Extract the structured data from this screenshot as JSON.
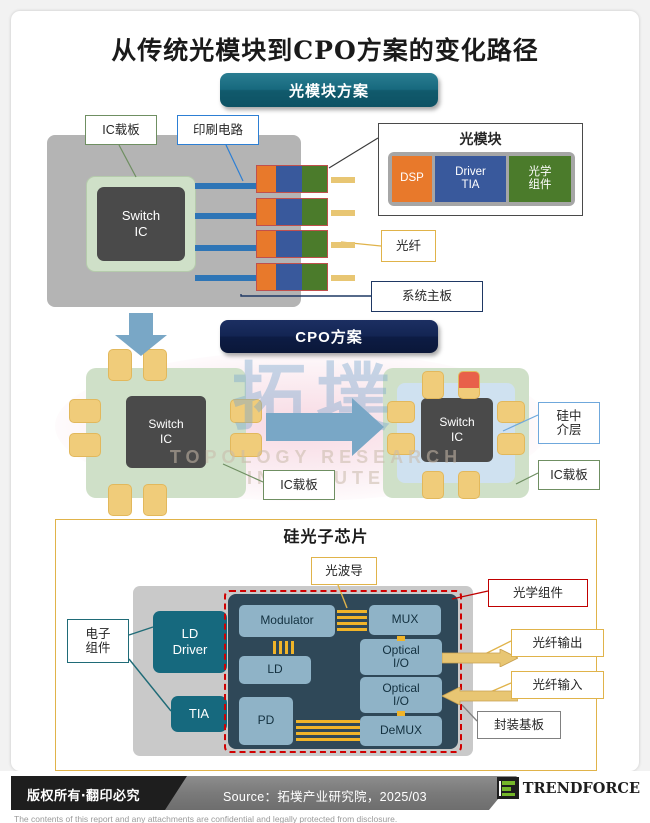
{
  "page": {
    "title": "从传统光模块到CPO方案的变化路径"
  },
  "sections": {
    "optical_module": {
      "pill_label": "光模块方案",
      "labels": {
        "ic_substrate": "IC载板",
        "pcb": "印刷电路",
        "fiber": "光纤",
        "system_board": "系统主板"
      },
      "switch_ic": {
        "line1": "Switch",
        "line2": "IC"
      },
      "module_detail": {
        "caption": "光模块",
        "blocks": [
          {
            "label": "DSP",
            "color": "#e8792b"
          },
          {
            "label": "Driver\nTIA",
            "line1": "Driver",
            "line2": "TIA",
            "color": "#39599c"
          },
          {
            "label": "光学组件",
            "line1": "光学",
            "line2": "组件",
            "color": "#4b7b2b"
          }
        ]
      }
    },
    "cpo": {
      "pill_label": "CPO方案",
      "switch_ic_left": {
        "line1": "Switch",
        "line2": "IC"
      },
      "switch_ic_right": {
        "line1": "Switch",
        "line2": "IC"
      },
      "labels": {
        "ic_substrate_left": "IC载板",
        "silicon_interposer": {
          "line1": "硅中",
          "line2": "介层"
        },
        "ic_substrate_right": "IC载板"
      }
    },
    "silicon_photonics": {
      "title": "硅光子芯片",
      "labels": {
        "electronic_components": {
          "line1": "电子",
          "line2": "组件"
        },
        "waveguide": "光波导",
        "optical_components": "光学组件",
        "fiber_output": "光纤输出",
        "fiber_input": "光纤输入",
        "package_substrate": "封装基板"
      },
      "electronic_blocks": [
        {
          "line1": "LD",
          "line2": "Driver"
        },
        {
          "line1": "TIA",
          "line2": ""
        }
      ],
      "photonic_blocks": [
        {
          "name": "Modulator"
        },
        {
          "name": "LD"
        },
        {
          "name": "PD"
        },
        {
          "name": "MUX"
        },
        {
          "line1": "Optical",
          "line2": "I/O"
        },
        {
          "line1": "Optical",
          "line2": "I/O"
        },
        {
          "name": "DeMUX"
        }
      ]
    }
  },
  "watermark": {
    "cn": "拓墣",
    "en": "TOPOLOGY RESEARCH INSTITUTE"
  },
  "footer": {
    "copyright": "版权所有‧翻印必究",
    "source": "Source：拓墣产业研究院，2025/03",
    "brand": "TRENDFORCE",
    "disclaimer": "The contents of this report and any attachments are confidential and legally protected from disclosure."
  },
  "colors": {
    "pill_teal": "#17697e",
    "pill_navy": "#132553",
    "board_gray": "#b4b4b4",
    "carrier_green": "#cfe0c8",
    "die_dark": "#4a4a4a",
    "trace_blue": "#2e75b6",
    "fiber_gold": "#e8c673",
    "pad_gold": "#f0cc7a",
    "interposer_blue": "#cfe1f0",
    "pic_navy": "#2f4858",
    "pic_block_blue": "#8fb3c7",
    "electronic_teal": "#16697e",
    "dash_red": "#d00000",
    "frame_gold": "#e0b34a",
    "brand_green": "#76b82a"
  }
}
